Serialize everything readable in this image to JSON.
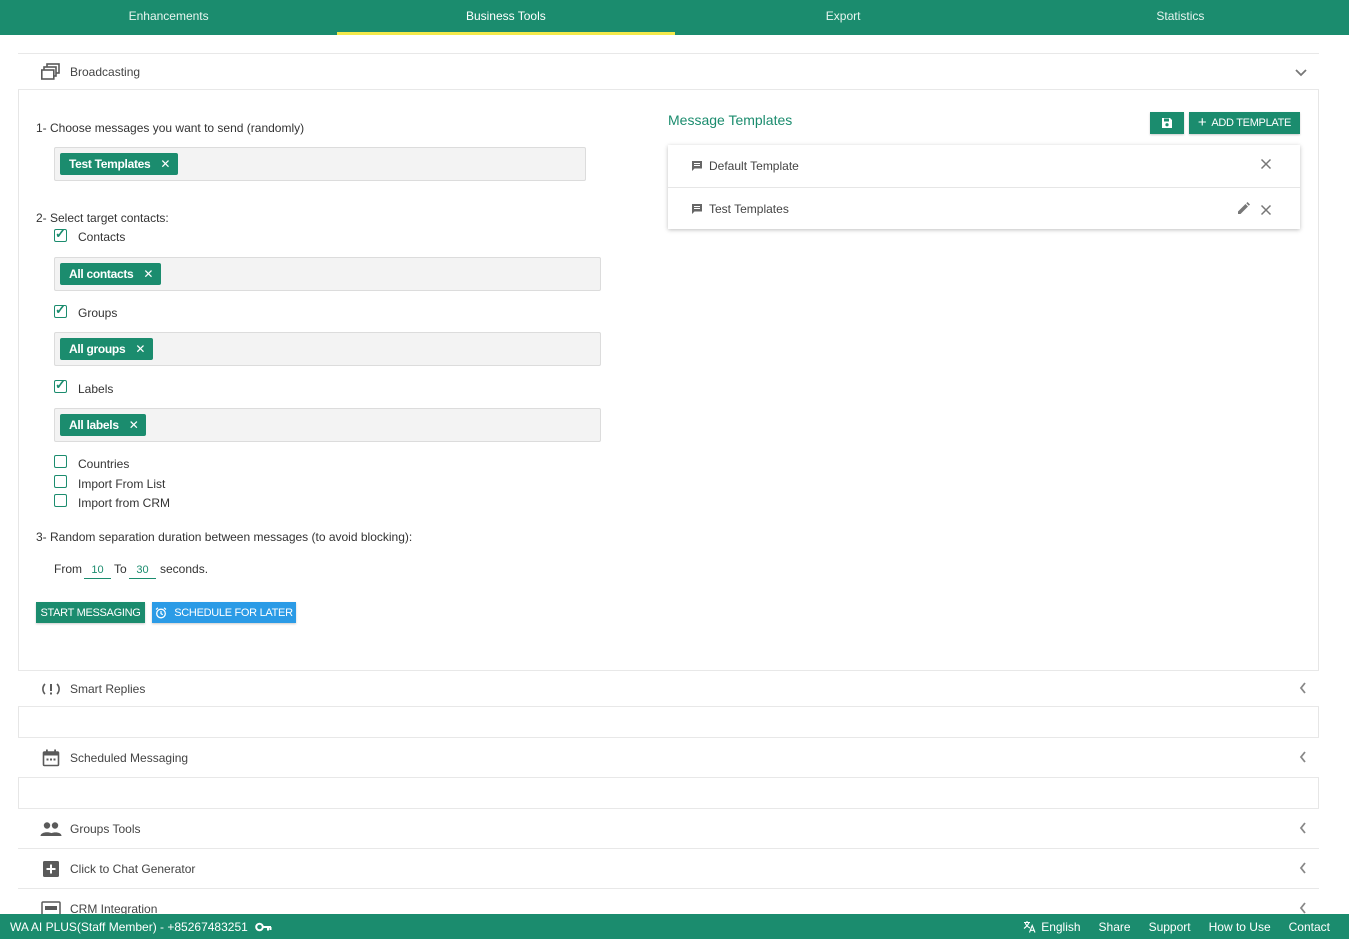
{
  "nav": {
    "tabs": [
      "Enhancements",
      "Business Tools",
      "Export",
      "Statistics"
    ],
    "active": "Business Tools"
  },
  "broadcasting": {
    "title": "Broadcasting",
    "step1": "1- Choose messages you want to send (randomly)",
    "selected_templates": "Test Templates",
    "step2": "2- Select target contacts:",
    "contacts_label": "Contacts",
    "contacts_chip": "All contacts",
    "groups_label": "Groups",
    "groups_chip": "All groups",
    "labels_label": "Labels",
    "labels_chip": "All labels",
    "countries_label": "Countries",
    "import_list_label": "Import From List",
    "import_crm_label": "Import from CRM",
    "step3": "3- Random separation duration between messages (to avoid blocking):",
    "from_label": "From",
    "from_value": "10",
    "to_label": "To",
    "to_value": "30",
    "seconds_label": "seconds.",
    "start_button": "START MESSAGING",
    "schedule_button": "SCHEDULE FOR LATER"
  },
  "templates": {
    "title": "Message Templates",
    "add_button": "ADD TEMPLATE",
    "items": [
      "Default Template",
      "Test Templates"
    ]
  },
  "sections": {
    "smart_replies": "Smart Replies",
    "scheduled_messaging": "Scheduled Messaging",
    "groups_tools": "Groups Tools",
    "click_to_chat": "Click to Chat Generator",
    "crm_integration": "CRM Integration"
  },
  "footer": {
    "account": "WA AI PLUS(Staff Member) - +85267483251",
    "language": "English",
    "share": "Share",
    "support": "Support",
    "how_to_use": "How to Use",
    "contact": "Contact"
  },
  "colors": {
    "primary": "#1b8c6e",
    "accent_tab": "#f3e94b",
    "schedule_blue": "#2b9be6"
  }
}
